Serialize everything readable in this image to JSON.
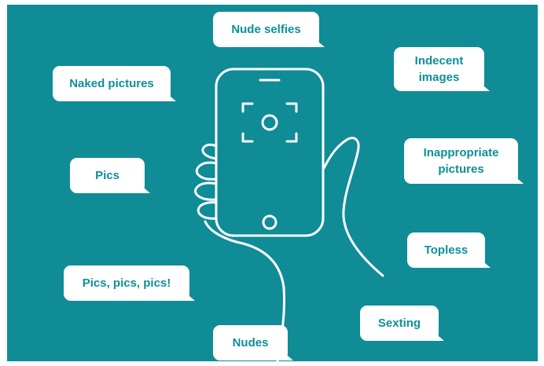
{
  "labels": {
    "nude_selfies": "Nude selfies",
    "indecent_images": "Indecent\nimages",
    "naked_pictures": "Naked pictures",
    "inappropriate_pictures": "Inappropriate\npictures",
    "pics": "Pics",
    "topless": "Topless",
    "pics_pics_pics": "Pics, pics, pics!",
    "sexting": "Sexting",
    "nudes": "Nudes"
  },
  "colors": {
    "background": "#0f8c96",
    "bubble": "#ffffff",
    "text": "#0d8f98",
    "line": "#ffffff"
  },
  "icons": [
    "hand-holding-phone-icon",
    "camera-focus-icon"
  ]
}
